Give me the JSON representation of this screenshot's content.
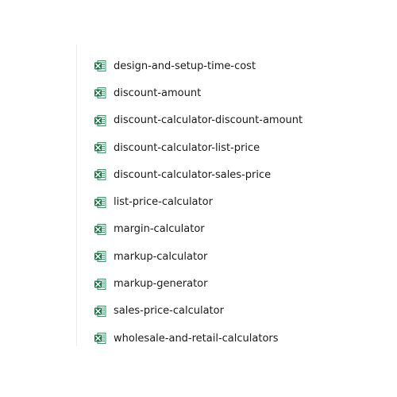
{
  "files": [
    {
      "name": "design-and-setup-time-cost",
      "icon": "excel-file-icon"
    },
    {
      "name": "discount-amount",
      "icon": "excel-file-icon"
    },
    {
      "name": "discount-calculator-discount-amount",
      "icon": "excel-file-icon"
    },
    {
      "name": "discount-calculator-list-price",
      "icon": "excel-file-icon"
    },
    {
      "name": "discount-calculator-sales-price",
      "icon": "excel-file-icon"
    },
    {
      "name": "list-price-calculator",
      "icon": "excel-file-icon"
    },
    {
      "name": "margin-calculator",
      "icon": "excel-file-icon"
    },
    {
      "name": "markup-calculator",
      "icon": "excel-file-icon"
    },
    {
      "name": "markup-generator",
      "icon": "excel-file-icon"
    },
    {
      "name": "sales-price-calculator",
      "icon": "excel-file-icon"
    },
    {
      "name": "wholesale-and-retail-calculators",
      "icon": "excel-file-icon"
    }
  ],
  "colors": {
    "excel_green": "#1f7244",
    "text": "#1a1a1a"
  }
}
